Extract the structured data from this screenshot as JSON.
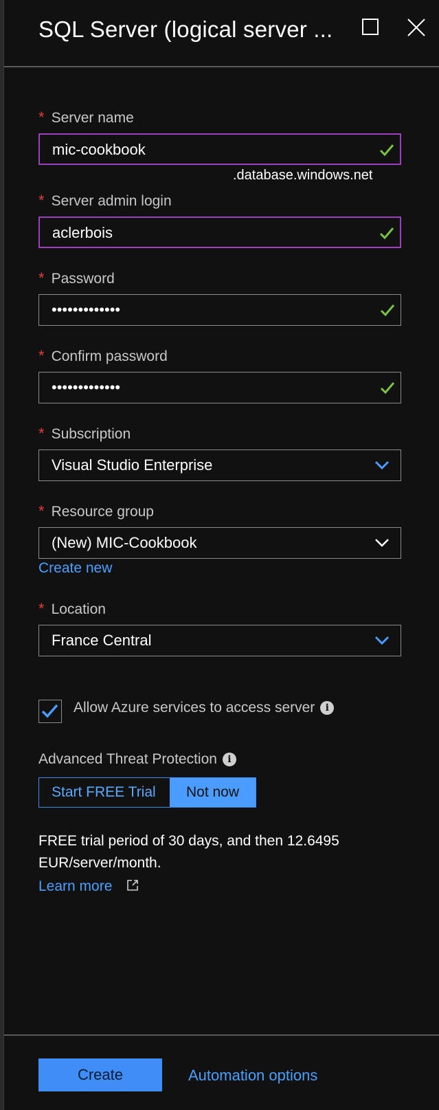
{
  "header": {
    "title": "SQL Server (logical server ...",
    "maximize_icon": "maximize-icon",
    "close_icon": "close-icon"
  },
  "fields": {
    "server_name": {
      "label": "Server name",
      "value": "mic-cookbook",
      "suffix": ".database.windows.net",
      "required": "*"
    },
    "admin_login": {
      "label": "Server admin login",
      "value": "aclerbois",
      "required": "*"
    },
    "password": {
      "label": "Password",
      "value": "•••••••••••••",
      "required": "*"
    },
    "confirm_password": {
      "label": "Confirm password",
      "value": "•••••••••••••",
      "required": "*"
    },
    "subscription": {
      "label": "Subscription",
      "value": "Visual Studio Enterprise",
      "required": "*"
    },
    "resource_group": {
      "label": "Resource group",
      "value": "(New) MIC-Cookbook",
      "required": "*",
      "create_new": "Create new"
    },
    "location": {
      "label": "Location",
      "value": "France Central",
      "required": "*"
    }
  },
  "allow_azure": {
    "label": "Allow Azure services to access server",
    "checked": true
  },
  "threat_protection": {
    "label": "Advanced Threat Protection",
    "options": [
      "Start FREE Trial",
      "Not now"
    ],
    "selected": "Not now",
    "description": "FREE trial period of 30 days, and then 12.6495 EUR/server/month.",
    "learn_more": "Learn more"
  },
  "footer": {
    "create_label": "Create",
    "automation_label": "Automation options"
  },
  "colors": {
    "background": "#111111",
    "accent_blue": "#4a9cff",
    "focus_purple": "#9c3fc0",
    "check_green": "#7cc242",
    "required_red": "#e23e3e"
  }
}
